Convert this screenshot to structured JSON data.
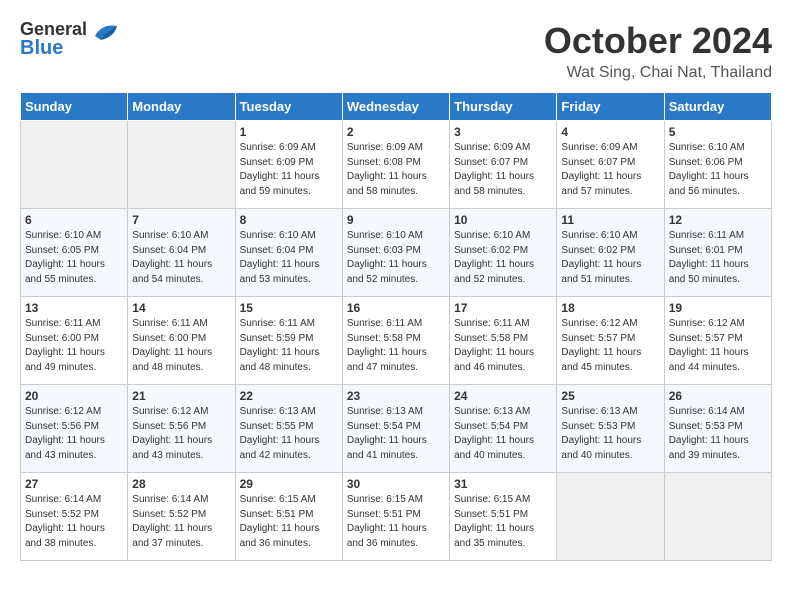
{
  "header": {
    "logo_general": "General",
    "logo_blue": "Blue",
    "month": "October 2024",
    "location": "Wat Sing, Chai Nat, Thailand"
  },
  "days_of_week": [
    "Sunday",
    "Monday",
    "Tuesday",
    "Wednesday",
    "Thursday",
    "Friday",
    "Saturday"
  ],
  "weeks": [
    [
      {
        "day": "",
        "sunrise": "",
        "sunset": "",
        "daylight": "",
        "empty": true
      },
      {
        "day": "",
        "sunrise": "",
        "sunset": "",
        "daylight": "",
        "empty": true
      },
      {
        "day": "1",
        "sunrise": "Sunrise: 6:09 AM",
        "sunset": "Sunset: 6:09 PM",
        "daylight": "Daylight: 11 hours and 59 minutes."
      },
      {
        "day": "2",
        "sunrise": "Sunrise: 6:09 AM",
        "sunset": "Sunset: 6:08 PM",
        "daylight": "Daylight: 11 hours and 58 minutes."
      },
      {
        "day": "3",
        "sunrise": "Sunrise: 6:09 AM",
        "sunset": "Sunset: 6:07 PM",
        "daylight": "Daylight: 11 hours and 58 minutes."
      },
      {
        "day": "4",
        "sunrise": "Sunrise: 6:09 AM",
        "sunset": "Sunset: 6:07 PM",
        "daylight": "Daylight: 11 hours and 57 minutes."
      },
      {
        "day": "5",
        "sunrise": "Sunrise: 6:10 AM",
        "sunset": "Sunset: 6:06 PM",
        "daylight": "Daylight: 11 hours and 56 minutes."
      }
    ],
    [
      {
        "day": "6",
        "sunrise": "Sunrise: 6:10 AM",
        "sunset": "Sunset: 6:05 PM",
        "daylight": "Daylight: 11 hours and 55 minutes."
      },
      {
        "day": "7",
        "sunrise": "Sunrise: 6:10 AM",
        "sunset": "Sunset: 6:04 PM",
        "daylight": "Daylight: 11 hours and 54 minutes."
      },
      {
        "day": "8",
        "sunrise": "Sunrise: 6:10 AM",
        "sunset": "Sunset: 6:04 PM",
        "daylight": "Daylight: 11 hours and 53 minutes."
      },
      {
        "day": "9",
        "sunrise": "Sunrise: 6:10 AM",
        "sunset": "Sunset: 6:03 PM",
        "daylight": "Daylight: 11 hours and 52 minutes."
      },
      {
        "day": "10",
        "sunrise": "Sunrise: 6:10 AM",
        "sunset": "Sunset: 6:02 PM",
        "daylight": "Daylight: 11 hours and 52 minutes."
      },
      {
        "day": "11",
        "sunrise": "Sunrise: 6:10 AM",
        "sunset": "Sunset: 6:02 PM",
        "daylight": "Daylight: 11 hours and 51 minutes."
      },
      {
        "day": "12",
        "sunrise": "Sunrise: 6:11 AM",
        "sunset": "Sunset: 6:01 PM",
        "daylight": "Daylight: 11 hours and 50 minutes."
      }
    ],
    [
      {
        "day": "13",
        "sunrise": "Sunrise: 6:11 AM",
        "sunset": "Sunset: 6:00 PM",
        "daylight": "Daylight: 11 hours and 49 minutes."
      },
      {
        "day": "14",
        "sunrise": "Sunrise: 6:11 AM",
        "sunset": "Sunset: 6:00 PM",
        "daylight": "Daylight: 11 hours and 48 minutes."
      },
      {
        "day": "15",
        "sunrise": "Sunrise: 6:11 AM",
        "sunset": "Sunset: 5:59 PM",
        "daylight": "Daylight: 11 hours and 48 minutes."
      },
      {
        "day": "16",
        "sunrise": "Sunrise: 6:11 AM",
        "sunset": "Sunset: 5:58 PM",
        "daylight": "Daylight: 11 hours and 47 minutes."
      },
      {
        "day": "17",
        "sunrise": "Sunrise: 6:11 AM",
        "sunset": "Sunset: 5:58 PM",
        "daylight": "Daylight: 11 hours and 46 minutes."
      },
      {
        "day": "18",
        "sunrise": "Sunrise: 6:12 AM",
        "sunset": "Sunset: 5:57 PM",
        "daylight": "Daylight: 11 hours and 45 minutes."
      },
      {
        "day": "19",
        "sunrise": "Sunrise: 6:12 AM",
        "sunset": "Sunset: 5:57 PM",
        "daylight": "Daylight: 11 hours and 44 minutes."
      }
    ],
    [
      {
        "day": "20",
        "sunrise": "Sunrise: 6:12 AM",
        "sunset": "Sunset: 5:56 PM",
        "daylight": "Daylight: 11 hours and 43 minutes."
      },
      {
        "day": "21",
        "sunrise": "Sunrise: 6:12 AM",
        "sunset": "Sunset: 5:56 PM",
        "daylight": "Daylight: 11 hours and 43 minutes."
      },
      {
        "day": "22",
        "sunrise": "Sunrise: 6:13 AM",
        "sunset": "Sunset: 5:55 PM",
        "daylight": "Daylight: 11 hours and 42 minutes."
      },
      {
        "day": "23",
        "sunrise": "Sunrise: 6:13 AM",
        "sunset": "Sunset: 5:54 PM",
        "daylight": "Daylight: 11 hours and 41 minutes."
      },
      {
        "day": "24",
        "sunrise": "Sunrise: 6:13 AM",
        "sunset": "Sunset: 5:54 PM",
        "daylight": "Daylight: 11 hours and 40 minutes."
      },
      {
        "day": "25",
        "sunrise": "Sunrise: 6:13 AM",
        "sunset": "Sunset: 5:53 PM",
        "daylight": "Daylight: 11 hours and 40 minutes."
      },
      {
        "day": "26",
        "sunrise": "Sunrise: 6:14 AM",
        "sunset": "Sunset: 5:53 PM",
        "daylight": "Daylight: 11 hours and 39 minutes."
      }
    ],
    [
      {
        "day": "27",
        "sunrise": "Sunrise: 6:14 AM",
        "sunset": "Sunset: 5:52 PM",
        "daylight": "Daylight: 11 hours and 38 minutes."
      },
      {
        "day": "28",
        "sunrise": "Sunrise: 6:14 AM",
        "sunset": "Sunset: 5:52 PM",
        "daylight": "Daylight: 11 hours and 37 minutes."
      },
      {
        "day": "29",
        "sunrise": "Sunrise: 6:15 AM",
        "sunset": "Sunset: 5:51 PM",
        "daylight": "Daylight: 11 hours and 36 minutes."
      },
      {
        "day": "30",
        "sunrise": "Sunrise: 6:15 AM",
        "sunset": "Sunset: 5:51 PM",
        "daylight": "Daylight: 11 hours and 36 minutes."
      },
      {
        "day": "31",
        "sunrise": "Sunrise: 6:15 AM",
        "sunset": "Sunset: 5:51 PM",
        "daylight": "Daylight: 11 hours and 35 minutes."
      },
      {
        "day": "",
        "sunrise": "",
        "sunset": "",
        "daylight": "",
        "empty": true
      },
      {
        "day": "",
        "sunrise": "",
        "sunset": "",
        "daylight": "",
        "empty": true
      }
    ]
  ]
}
